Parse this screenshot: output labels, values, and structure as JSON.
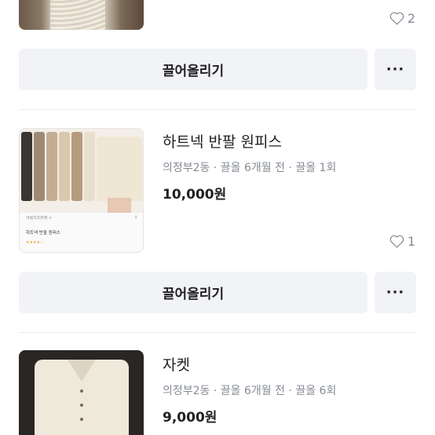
{
  "items": [
    {
      "title": "",
      "meta": "",
      "price": "",
      "likes": "2",
      "bump_label": "끌어올리기",
      "more_label": "···"
    },
    {
      "title": "하트넥 반팔 원피스",
      "meta": "의정부2동 · 끌올 6개월 전 · 끌올 1회",
      "price": "10,000원",
      "likes": "1",
      "bump_label": "끌어올리기",
      "more_label": "···",
      "thumb": {
        "shop": "크림치즈마켓 >",
        "name": "하트넥 반팔 원피스",
        "stars": "★★★★☆"
      }
    },
    {
      "title": "자켓",
      "meta": "의정부2동 · 끌올 6개월 전 · 끌올 6회",
      "price": "9,000원"
    }
  ]
}
